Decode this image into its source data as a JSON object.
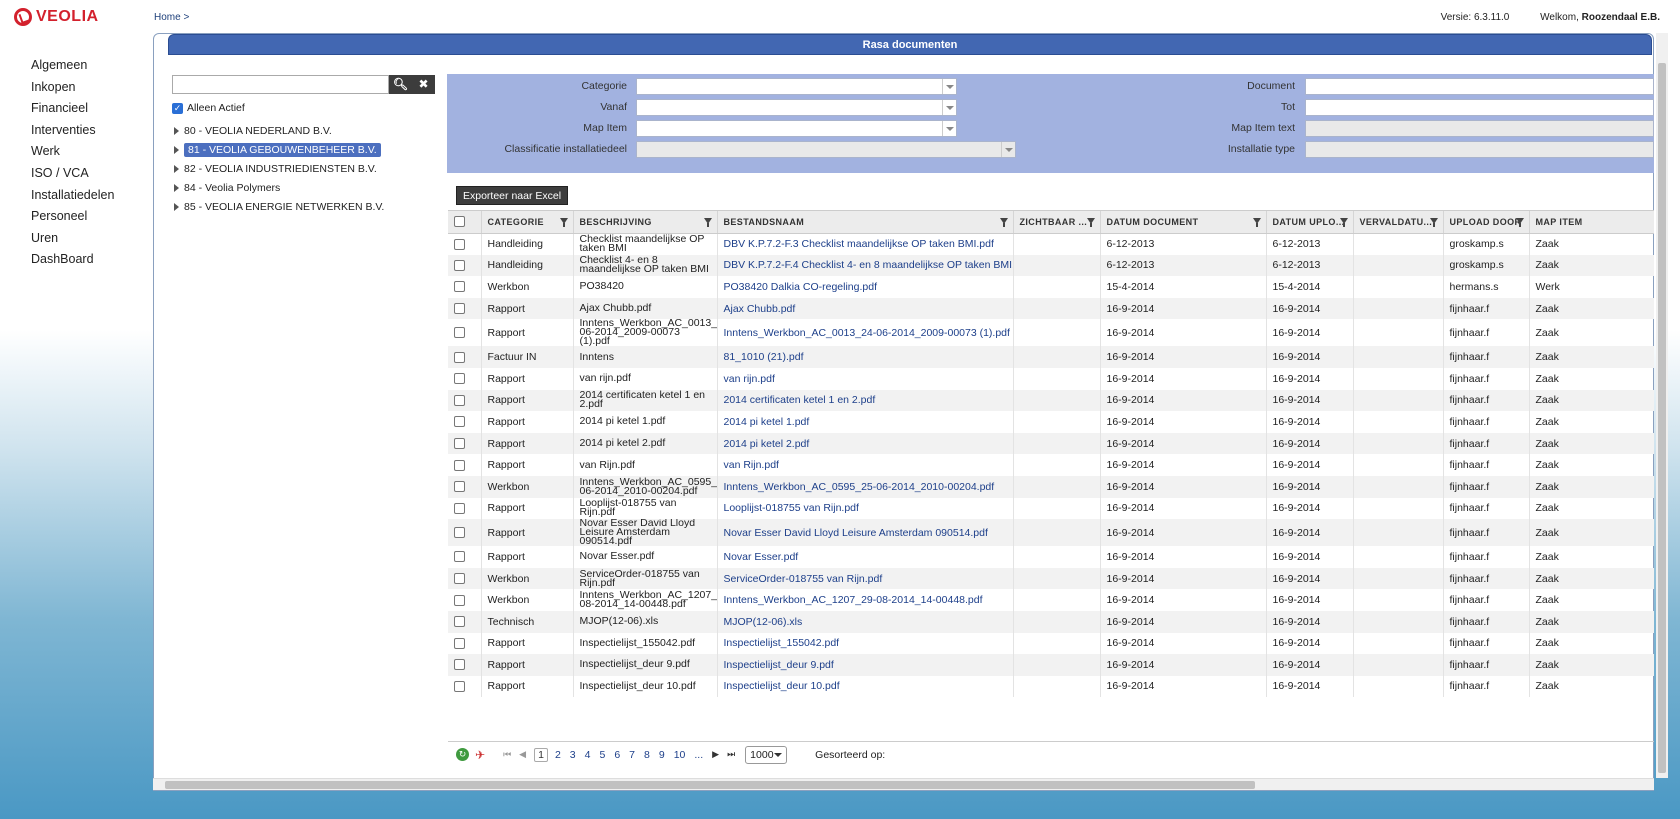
{
  "header": {
    "logo_text": "VEOLIA",
    "breadcrumb": "Home >",
    "version": "Versie: 6.3.11.0",
    "welcome_prefix": "Welkom,",
    "user_name": "Roozendaal E.B."
  },
  "nav": [
    "Algemeen",
    "Inkopen",
    "Financieel",
    "Interventies",
    "Werk",
    "ISO / VCA",
    "Installatiedelen",
    "Personeel",
    "Uren",
    "DashBoard"
  ],
  "panel": {
    "title": "Rasa documenten",
    "search_placeholder": "",
    "search_icon": "search-icon",
    "clear_icon": "close-icon",
    "active_only_label": "Alleen Actief",
    "active_only_checked": true,
    "tree": [
      {
        "label": "80 - VEOLIA NEDERLAND B.V.",
        "selected": false
      },
      {
        "label": "81 - VEOLIA GEBOUWENBEHEER B.V.",
        "selected": true
      },
      {
        "label": "82 - VEOLIA INDUSTRIEDIENSTEN B.V.",
        "selected": false
      },
      {
        "label": "84 - Veolia Polymers",
        "selected": false
      },
      {
        "label": "85 - VEOLIA ENERGIE NETWERKEN B.V.",
        "selected": false
      }
    ]
  },
  "filters": {
    "categorie": "Categorie",
    "vanaf": "Vanaf",
    "map_item": "Map Item",
    "classificatie": "Classificatie installatiedeel",
    "document": "Document",
    "tot": "Tot",
    "map_item_text": "Map Item text",
    "installatie_type": "Installatie type"
  },
  "export_label": "Exporteer naar Excel",
  "columns": [
    "CATEGORIE",
    "BESCHRIJVING",
    "BESTANDSNAAM",
    "ZICHTBAAR ...",
    "DATUM DOCUMENT",
    "DATUM UPLO...",
    "VERVALDATU...",
    "UPLOAD DOOR",
    "MAP ITEM"
  ],
  "rows": [
    [
      "Handleiding",
      "Checklist maandelijkse OP taken BMI",
      "DBV K.P.7.2-F.3 Checklist maandelijkse OP taken BMI.pdf",
      "",
      "6-12-2013",
      "6-12-2013",
      "",
      "groskamp.s",
      "Zaak"
    ],
    [
      "Handleiding",
      "Checklist 4- en 8 maandelijkse OP taken BMI",
      "DBV K.P.7.2-F.4 Checklist 4- en 8 maandelijkse OP taken BMI.pdf",
      "",
      "6-12-2013",
      "6-12-2013",
      "",
      "groskamp.s",
      "Zaak"
    ],
    [
      "Werkbon",
      "PO38420",
      "PO38420 Dalkia CO-regeling.pdf",
      "",
      "15-4-2014",
      "15-4-2014",
      "",
      "hermans.s",
      "Werk"
    ],
    [
      "Rapport",
      "Ajax Chubb.pdf",
      "Ajax Chubb.pdf",
      "",
      "16-9-2014",
      "16-9-2014",
      "",
      "fijnhaar.f",
      "Zaak"
    ],
    [
      "Rapport",
      "Inntens_Werkbon_AC_0013_24-06-2014_2009-00073 (1).pdf",
      "Inntens_Werkbon_AC_0013_24-06-2014_2009-00073 (1).pdf",
      "",
      "16-9-2014",
      "16-9-2014",
      "",
      "fijnhaar.f",
      "Zaak"
    ],
    [
      "Factuur IN",
      "Inntens",
      "81_1010 (21).pdf",
      "",
      "16-9-2014",
      "16-9-2014",
      "",
      "fijnhaar.f",
      "Zaak"
    ],
    [
      "Rapport",
      "van rijn.pdf",
      "van rijn.pdf",
      "",
      "16-9-2014",
      "16-9-2014",
      "",
      "fijnhaar.f",
      "Zaak"
    ],
    [
      "Rapport",
      "2014 certificaten ketel 1 en 2.pdf",
      "2014 certificaten ketel 1 en 2.pdf",
      "",
      "16-9-2014",
      "16-9-2014",
      "",
      "fijnhaar.f",
      "Zaak"
    ],
    [
      "Rapport",
      "2014 pi ketel 1.pdf",
      "2014 pi ketel 1.pdf",
      "",
      "16-9-2014",
      "16-9-2014",
      "",
      "fijnhaar.f",
      "Zaak"
    ],
    [
      "Rapport",
      "2014 pi ketel 2.pdf",
      "2014 pi ketel 2.pdf",
      "",
      "16-9-2014",
      "16-9-2014",
      "",
      "fijnhaar.f",
      "Zaak"
    ],
    [
      "Rapport",
      "van Rijn.pdf",
      "van Rijn.pdf",
      "",
      "16-9-2014",
      "16-9-2014",
      "",
      "fijnhaar.f",
      "Zaak"
    ],
    [
      "Werkbon",
      "Inntens_Werkbon_AC_0595_25-06-2014_2010-00204.pdf",
      "Inntens_Werkbon_AC_0595_25-06-2014_2010-00204.pdf",
      "",
      "16-9-2014",
      "16-9-2014",
      "",
      "fijnhaar.f",
      "Zaak"
    ],
    [
      "Rapport",
      "Looplijst-018755 van Rijn.pdf",
      "Looplijst-018755 van Rijn.pdf",
      "",
      "16-9-2014",
      "16-9-2014",
      "",
      "fijnhaar.f",
      "Zaak"
    ],
    [
      "Rapport",
      "Novar Esser David Lloyd Leisure Amsterdam 090514.pdf",
      "Novar Esser David Lloyd Leisure Amsterdam 090514.pdf",
      "",
      "16-9-2014",
      "16-9-2014",
      "",
      "fijnhaar.f",
      "Zaak"
    ],
    [
      "Rapport",
      "Novar Esser.pdf",
      "Novar Esser.pdf",
      "",
      "16-9-2014",
      "16-9-2014",
      "",
      "fijnhaar.f",
      "Zaak"
    ],
    [
      "Werkbon",
      "ServiceOrder-018755 van Rijn.pdf",
      "ServiceOrder-018755 van Rijn.pdf",
      "",
      "16-9-2014",
      "16-9-2014",
      "",
      "fijnhaar.f",
      "Zaak"
    ],
    [
      "Werkbon",
      "Inntens_Werkbon_AC_1207_29-08-2014_14-00448.pdf",
      "Inntens_Werkbon_AC_1207_29-08-2014_14-00448.pdf",
      "",
      "16-9-2014",
      "16-9-2014",
      "",
      "fijnhaar.f",
      "Zaak"
    ],
    [
      "Technisch",
      "MJOP(12-06).xls",
      "MJOP(12-06).xls",
      "",
      "16-9-2014",
      "16-9-2014",
      "",
      "fijnhaar.f",
      "Zaak"
    ],
    [
      "Rapport",
      "Inspectielijst_155042.pdf",
      "Inspectielijst_155042.pdf",
      "",
      "16-9-2014",
      "16-9-2014",
      "",
      "fijnhaar.f",
      "Zaak"
    ],
    [
      "Rapport",
      "Inspectielijst_deur 9.pdf",
      "Inspectielijst_deur 9.pdf",
      "",
      "16-9-2014",
      "16-9-2014",
      "",
      "fijnhaar.f",
      "Zaak"
    ],
    [
      "Rapport",
      "Inspectielijst_deur 10.pdf",
      "Inspectielijst_deur 10.pdf",
      "",
      "16-9-2014",
      "16-9-2014",
      "",
      "fijnhaar.f",
      "Zaak"
    ]
  ],
  "pager": {
    "pages": [
      "1",
      "2",
      "3",
      "4",
      "5",
      "6",
      "7",
      "8",
      "9",
      "10",
      "..."
    ],
    "current": "1",
    "page_size": "1000",
    "sorted_label": "Gesorteerd op:"
  },
  "colors": {
    "brand_red": "#d3212d",
    "title_bar": "#4267b2",
    "filter_bg": "#a2b2e0",
    "link": "#1d3f8a"
  }
}
